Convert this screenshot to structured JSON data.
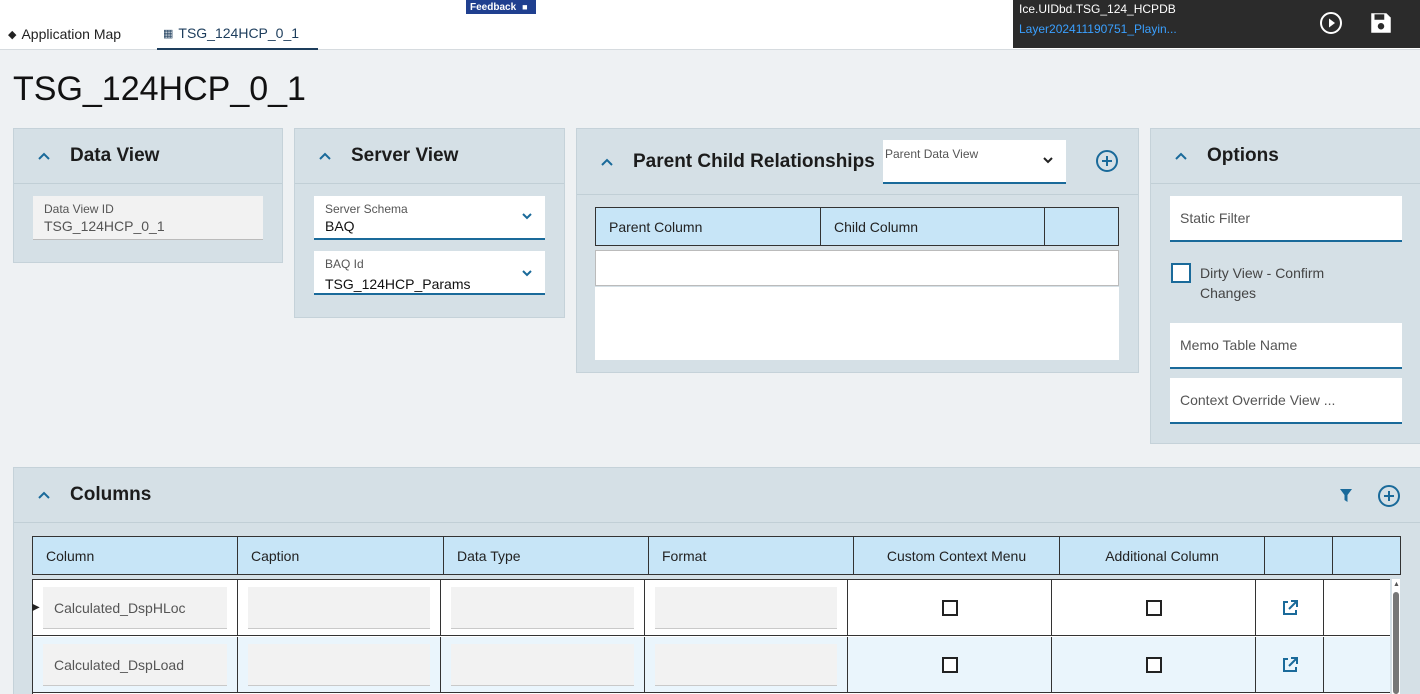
{
  "tabs": [
    {
      "label": "Application Map",
      "icon": "layers-icon"
    },
    {
      "label": "TSG_124HCP_0_1",
      "icon": "grid-icon",
      "active": true
    }
  ],
  "feedback": {
    "label": "Feedback"
  },
  "header": {
    "layer_title": "Ice.UIDbd.TSG_124_HCPDB",
    "layer_name": "Layer202411190751_Playin..."
  },
  "page_title": "TSG_124HCP_0_1",
  "data_view": {
    "title": "Data View",
    "id_label": "Data View ID",
    "id_value": "TSG_124HCP_0_1"
  },
  "server_view": {
    "title": "Server View",
    "schema_label": "Server Schema",
    "schema_value": "BAQ",
    "baq_label": "BAQ Id",
    "baq_value": "TSG_124HCP_Params"
  },
  "parent_child": {
    "title": "Parent Child Relationships",
    "parent_data_view_label": "Parent Data View",
    "columns": [
      "Parent Column",
      "Child Column",
      ""
    ]
  },
  "options": {
    "title": "Options",
    "static_filter": "Static Filter",
    "dirty_view_label": "Dirty View - Confirm Changes",
    "memo_table": "Memo Table Name",
    "context_override": "Context Override View ..."
  },
  "columns_panel": {
    "title": "Columns",
    "headers": [
      "Column",
      "Caption",
      "Data Type",
      "Format",
      "Custom Context Menu",
      "Additional Column",
      "",
      ""
    ],
    "rows": [
      {
        "column": "Calculated_DspHLoc",
        "caption": "",
        "data_type": "",
        "format": ""
      },
      {
        "column": "Calculated_DspLoad",
        "caption": "",
        "data_type": "",
        "format": ""
      }
    ]
  },
  "colors": {
    "accent": "#1a6a9a",
    "header_blue": "#c7e5f7",
    "panel_bg": "#d5e0e6",
    "dark_bar": "#2b2b2b"
  }
}
